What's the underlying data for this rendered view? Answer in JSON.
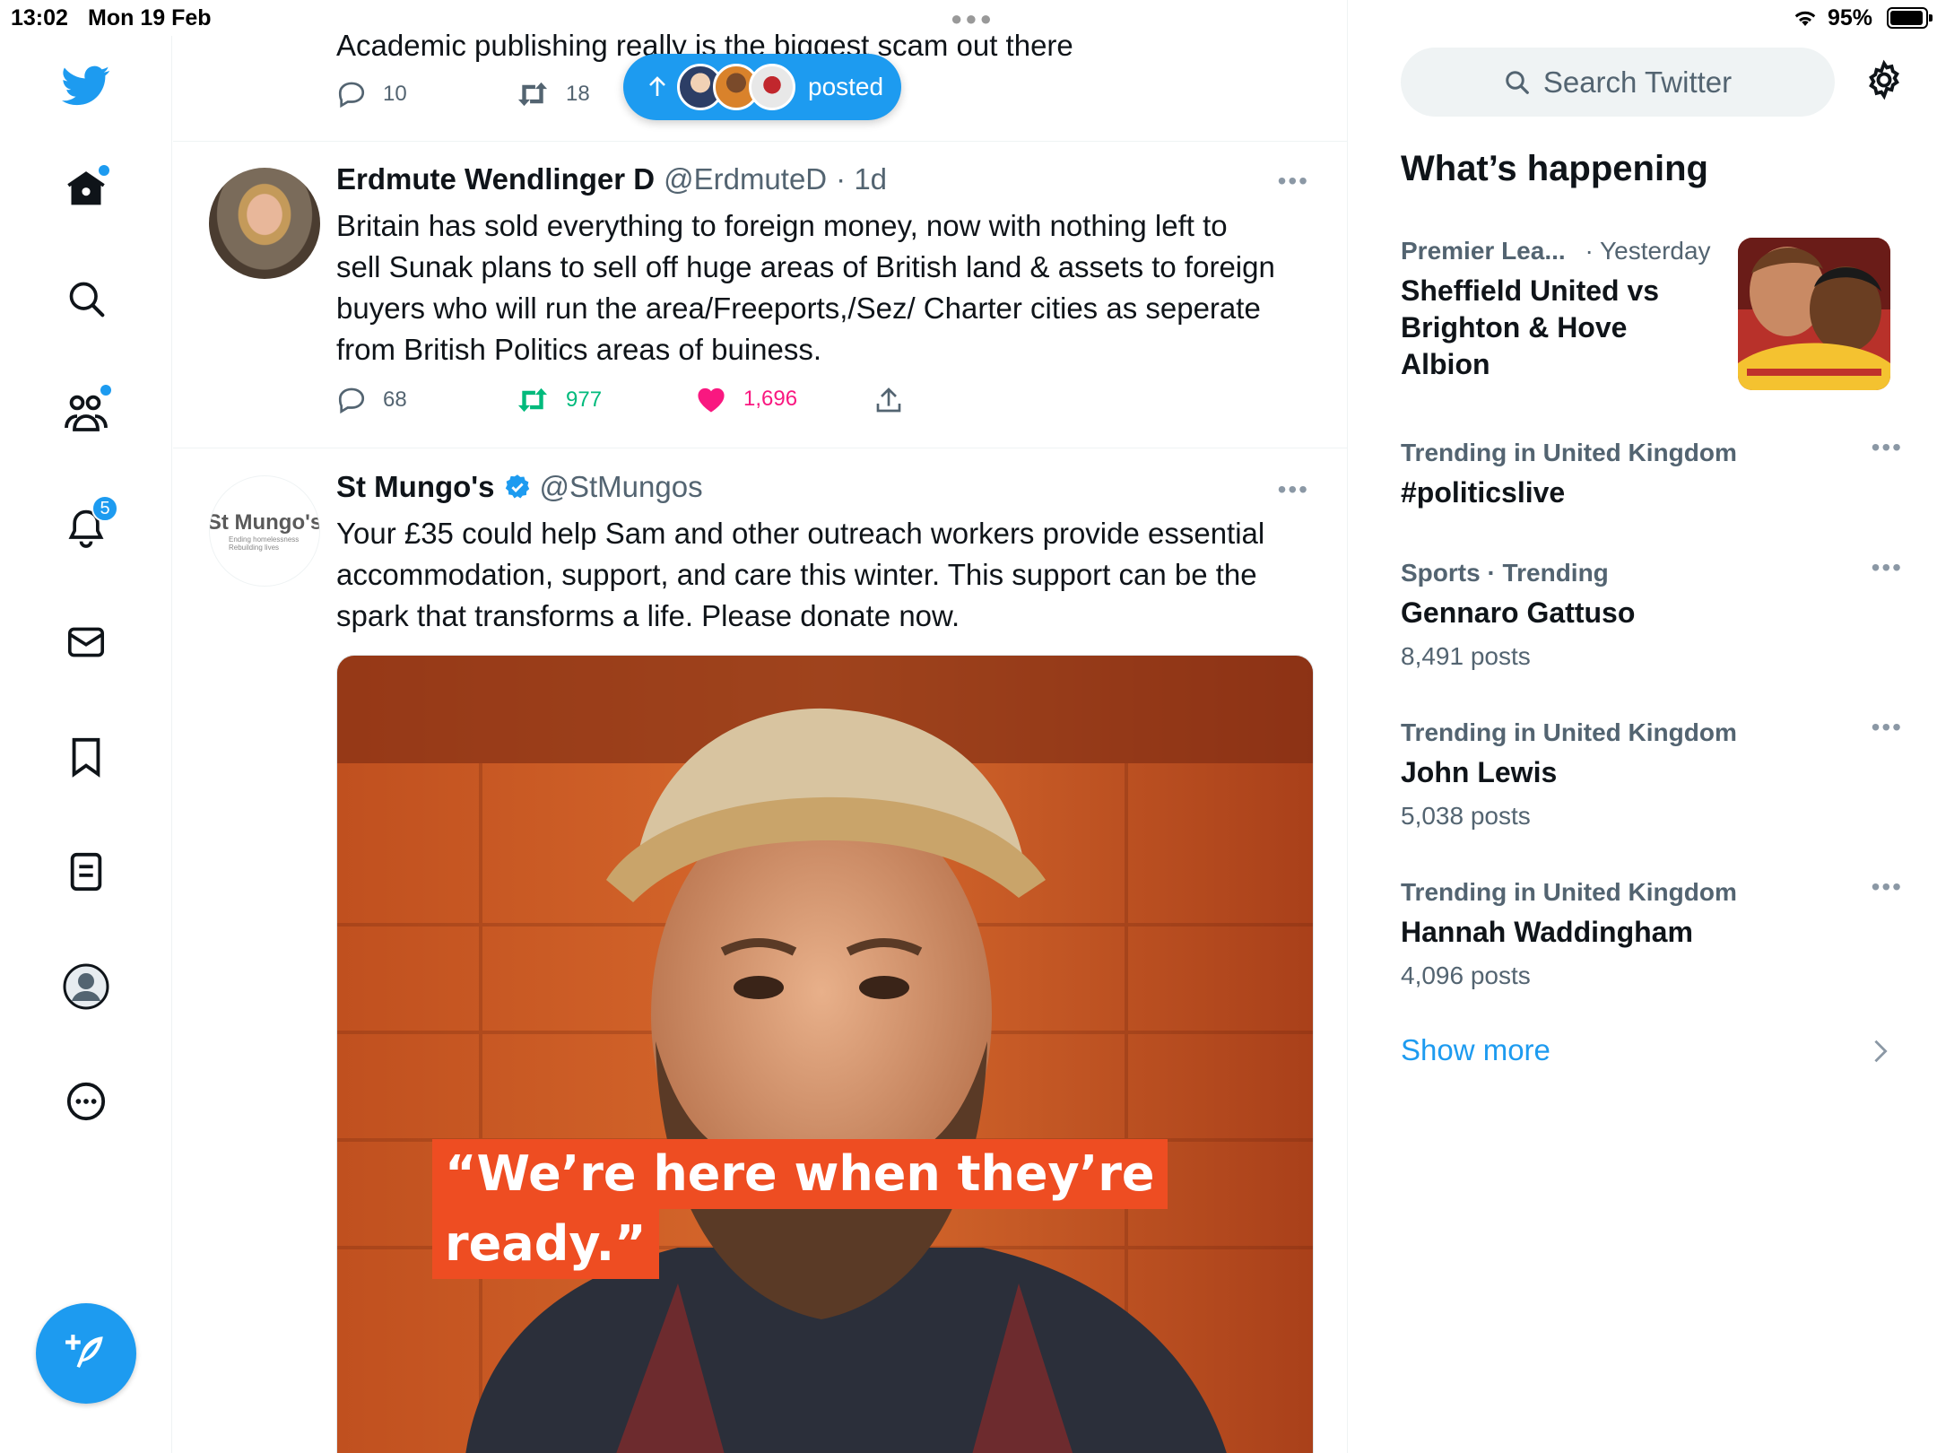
{
  "status_bar": {
    "time": "13:02",
    "date": "Mon 19 Feb",
    "battery_percent": "95%",
    "battery_level": 0.95
  },
  "nav": {
    "notifications_badge": "5",
    "icons": [
      "twitter-logo-icon",
      "home-icon",
      "search-icon",
      "communities-icon",
      "notifications-icon",
      "messages-icon",
      "bookmarks-icon",
      "lists-icon",
      "profile-icon",
      "more-icon",
      "compose-icon"
    ]
  },
  "timeline": {
    "tweet0": {
      "text": "Academic publishing really is the biggest scam out there",
      "replies": "10",
      "retweets": "18"
    },
    "posted_pill": {
      "label": "posted"
    },
    "tweet1": {
      "name": "Erdmute Wendlinger D",
      "handle": "@ErdmuteD",
      "time": "· 1d",
      "text_lines": [
        "Britain has sold everything  to foreign money, now with nothing left to",
        "sell Sunak plans to sell off huge areas of British land & assets to foreign",
        "buyers who will run the area/Freeports,/Sez/ Charter cities as seperate",
        "from British Politics areas of buiness."
      ],
      "replies": "68",
      "retweets": "977",
      "likes": "1,696"
    },
    "tweet2": {
      "name": "St Mungo's",
      "handle": "@StMungos",
      "avatar_logo": "St Mungo's",
      "avatar_tagline": "Ending homelessness Rebuilding lives",
      "text_lines": [
        "Your £35 could help Sam and other outreach workers provide essential",
        "accommodation, support, and care this winter. This support can be the",
        "spark that transforms a life. Please donate now."
      ],
      "image_quote_line1": "“We’re here when they’re",
      "image_quote_line2": "ready.”"
    }
  },
  "right": {
    "search_placeholder": "Search Twitter",
    "whats_happening": "What’s happening",
    "trends": [
      {
        "meta": "Premier Lea...",
        "meta2": "· Yesterday",
        "name_lines": [
          "Sheffield United vs",
          "Brighton & Hove",
          "Albion"
        ]
      },
      {
        "meta": "Trending in United Kingdom",
        "name": "#politicslive",
        "count": ""
      },
      {
        "meta": "Sports · Trending",
        "name": "Gennaro Gattuso",
        "count": "8,491 posts"
      },
      {
        "meta": "Trending in United Kingdom",
        "name": "John Lewis",
        "count": "5,038 posts"
      },
      {
        "meta": "Trending in United Kingdom",
        "name": "Hannah Waddingham",
        "count": "4,096 posts"
      }
    ],
    "show_more": "Show more"
  },
  "colors": {
    "accent": "#1d9bf0",
    "retweet_green": "#00ba7c",
    "like_pink": "#f91880",
    "secondary_text": "#536471"
  }
}
